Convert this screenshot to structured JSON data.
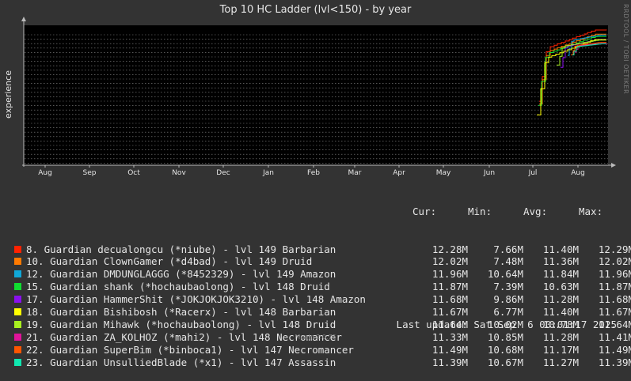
{
  "chart_data": {
    "type": "line",
    "title": "Top 10 HC Ladder (lvl<150) - by year",
    "ylabel": "experience",
    "xlabel": "",
    "x_ticks": [
      "Aug",
      "Sep",
      "Oct",
      "Nov",
      "Dec",
      "Jan",
      "Feb",
      "Mar",
      "Apr",
      "May",
      "Jun",
      "Jul",
      "Aug"
    ],
    "grid": true,
    "legend_position": "bottom",
    "headers": {
      "cur": "Cur:",
      "min": "Min:",
      "avg": "Avg:",
      "max": "Max:"
    },
    "series": [
      {
        "name": "8. Guardian decualongcu (*niube) - lvl 149 Barbarian",
        "color": "#ff2200",
        "cur": "12.28M",
        "min": "7.66M",
        "avg": "11.40M",
        "max": "12.29M"
      },
      {
        "name": "10. Guardian ClownGamer (*d4bad) - lvl 149 Druid",
        "color": "#ff7a00",
        "cur": "12.02M",
        "min": "7.48M",
        "avg": "11.36M",
        "max": "12.02M"
      },
      {
        "name": "12. Guardian DMDUNGLAGGG (*8452329) - lvl 149 Amazon",
        "color": "#10a8d8",
        "cur": "11.96M",
        "min": "10.64M",
        "avg": "11.84M",
        "max": "11.96M"
      },
      {
        "name": "15. Guardian shank (*hochaubaolong) - lvl 148 Druid",
        "color": "#10dd30",
        "cur": "11.87M",
        "min": "7.39M",
        "avg": "10.63M",
        "max": "11.87M"
      },
      {
        "name": "17. Guardian HammerShit (*JOKJOKJOK3210) - lvl 148 Amazon",
        "color": "#8a10ee",
        "cur": "11.68M",
        "min": "9.86M",
        "avg": "11.28M",
        "max": "11.68M"
      },
      {
        "name": "18. Guardian Bishibosh (*Racerx) - lvl 148 Barbarian",
        "color": "#ffff00",
        "cur": "11.67M",
        "min": "6.77M",
        "avg": "11.40M",
        "max": "11.67M"
      },
      {
        "name": "19. Guardian Mihawk (*hochaubaolong) - lvl 148 Druid",
        "color": "#a8f020",
        "cur": "11.64M",
        "min": "10.02M",
        "avg": "10.78M",
        "max": "11.64M"
      },
      {
        "name": "21. Guardian ZA_KOLHOZ (*mahi2) - lvl 148 Necromancer",
        "color": "#e0149a",
        "cur": "11.33M",
        "min": "10.85M",
        "avg": "11.28M",
        "max": "11.41M"
      },
      {
        "name": "22. Guardian SuperBim (*binboca1) - lvl 147 Necromancer",
        "color": "#ff5500",
        "cur": "11.49M",
        "min": "10.68M",
        "avg": "11.17M",
        "max": "11.49M"
      },
      {
        "name": "23. Guardian UnsulliedBlade (*x1) - lvl 147 Assassin",
        "color": "#10e8b0",
        "cur": "11.39M",
        "min": "10.67M",
        "avg": "11.27M",
        "max": "11.39M"
      }
    ],
    "last_update": "Last update: Sat Sep  6 00:01:17 2025",
    "side_label": "RRDTOOL / TOBI OETIKER",
    "footer": "Munin 2.0.75"
  }
}
